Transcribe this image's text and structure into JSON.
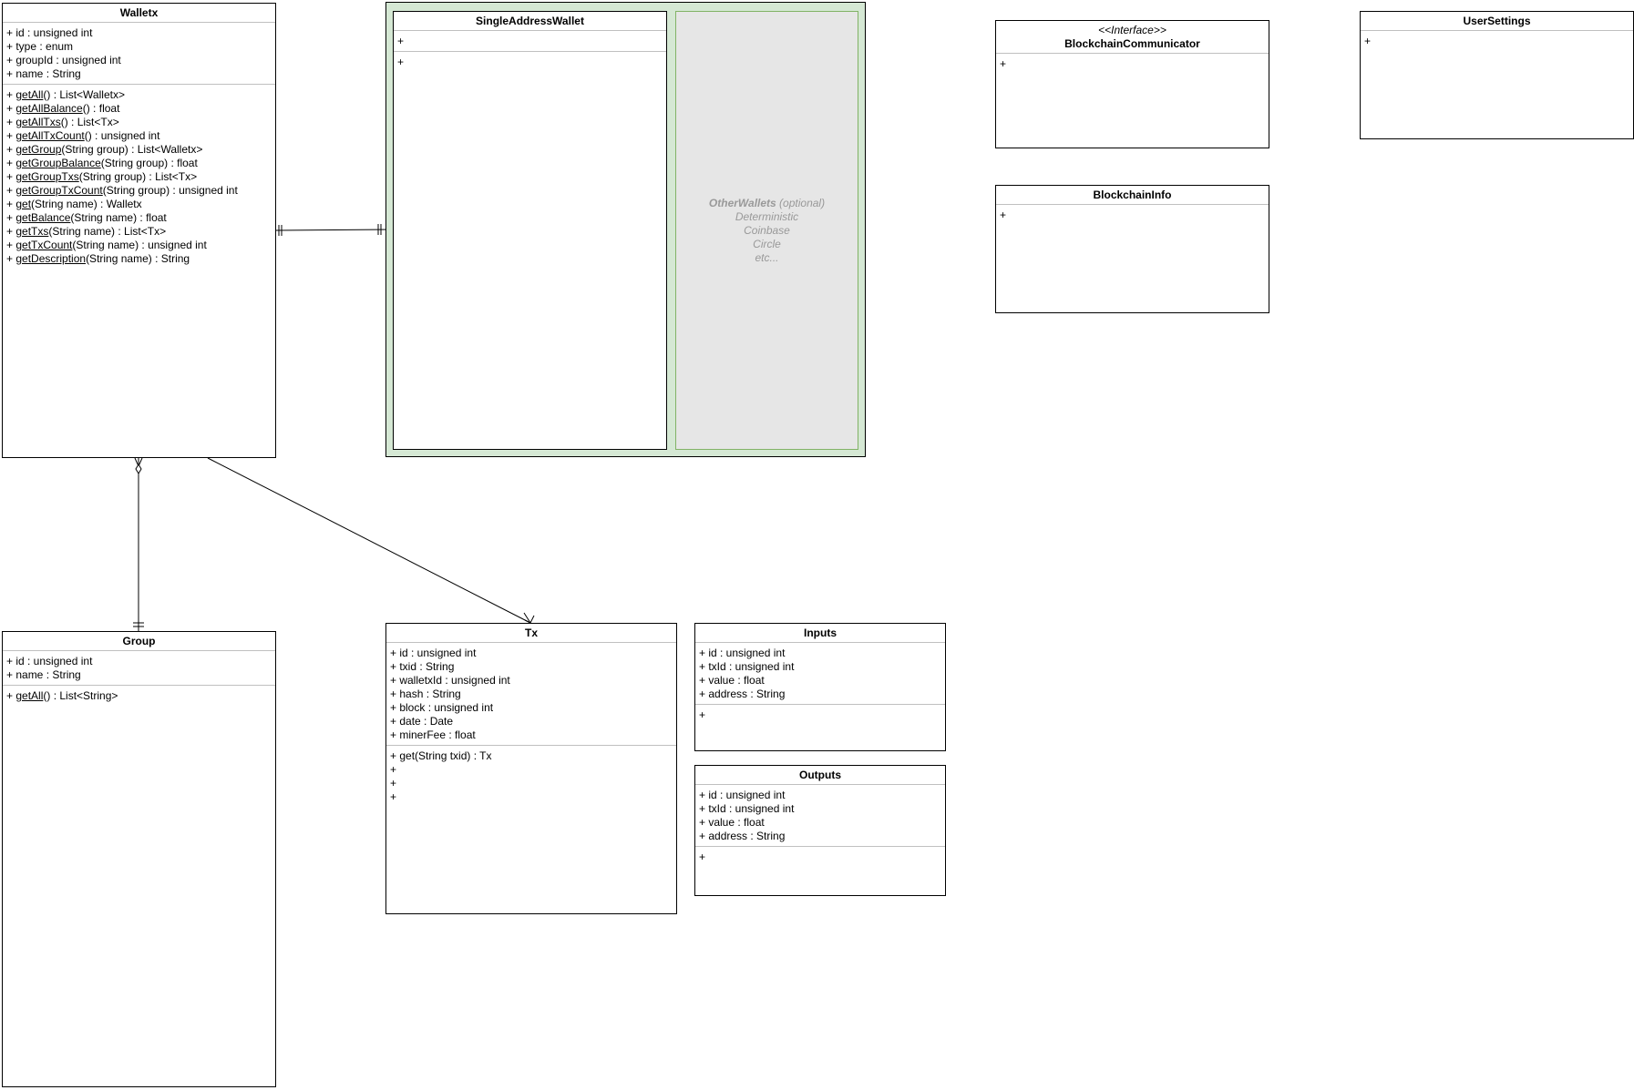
{
  "other_wallets": {
    "name": "OtherWallets",
    "suffix": " (optional)",
    "items": [
      "Deterministic",
      "Coinbase",
      "Circle",
      "etc..."
    ]
  },
  "walletx": {
    "title": "Walletx",
    "attributes": [
      "+ id : unsigned int",
      "+ type : enum",
      "+ groupId : unsigned int",
      "+ name : String"
    ],
    "methods": [
      {
        "pre": "+ ",
        "name": "getAll",
        "sig": "() : List<Walletx>"
      },
      {
        "pre": "+ ",
        "name": "getAllBalance",
        "sig": "() : float"
      },
      {
        "pre": "+ ",
        "name": "getAllTxs",
        "sig": "() : List<Tx>"
      },
      {
        "pre": "+ ",
        "name": "getAllTxCount",
        "sig": "() : unsigned int"
      },
      {
        "pre": "+ ",
        "name": "getGroup",
        "sig": "(String group) : List<Walletx>"
      },
      {
        "pre": "+ ",
        "name": "getGroupBalance",
        "sig": "(String group) : float"
      },
      {
        "pre": "+ ",
        "name": "getGroupTxs",
        "sig": "(String group) : List<Tx>"
      },
      {
        "pre": "+ ",
        "name": "getGroupTxCount",
        "sig": "(String group) : unsigned int"
      },
      {
        "pre": "+ ",
        "name": "get",
        "sig": "(String name) : Walletx"
      },
      {
        "pre": "+ ",
        "name": "getBalance",
        "sig": "(String name) : float"
      },
      {
        "pre": "+ ",
        "name": "getTxs",
        "sig": "(String name) : List<Tx>"
      },
      {
        "pre": "+ ",
        "name": "getTxCount",
        "sig": "(String name) : unsigned int"
      },
      {
        "pre": "+ ",
        "name": "getDescription",
        "sig": "(String name) : String"
      }
    ]
  },
  "single_address_wallet": {
    "title": "SingleAddressWallet",
    "attributes": [
      "+"
    ],
    "methods": [
      "+"
    ]
  },
  "blockchain_communicator": {
    "stereotype": "<<Interface>>",
    "title": "BlockchainCommunicator",
    "methods": [
      "+"
    ]
  },
  "user_settings": {
    "title": "UserSettings",
    "methods": [
      "+"
    ]
  },
  "blockchain_info": {
    "title": "BlockchainInfo",
    "methods": [
      "+"
    ]
  },
  "group": {
    "title": "Group",
    "attributes": [
      "+ id : unsigned int",
      "+ name : String"
    ],
    "methods": [
      {
        "pre": "+ ",
        "name": "getAll",
        "sig": "() : List<String>"
      }
    ]
  },
  "tx": {
    "title": "Tx",
    "attributes": [
      "+ id : unsigned int",
      "+ txid : String",
      "+ walletxId : unsigned int",
      "+ hash : String",
      "+ block : unsigned int",
      "+ date : Date",
      "+ minerFee : float"
    ],
    "methods": [
      "+ get(String txid) : Tx",
      "+",
      "+",
      "+"
    ]
  },
  "inputs": {
    "title": "Inputs",
    "attributes": [
      "+ id : unsigned int",
      "+ txId : unsigned int",
      "+ value : float",
      "+ address : String"
    ],
    "methods": [
      "+"
    ]
  },
  "outputs": {
    "title": "Outputs",
    "attributes": [
      "+ id : unsigned int",
      "+ txId : unsigned int",
      "+ value : float",
      "+ address : String"
    ],
    "methods": [
      "+"
    ]
  }
}
